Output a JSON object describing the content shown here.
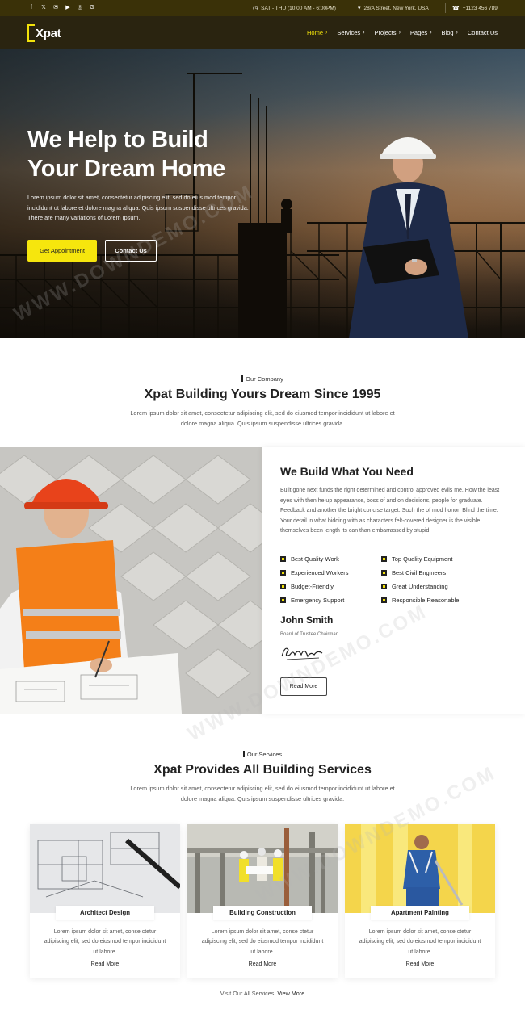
{
  "topbar": {
    "social_icons": [
      "facebook-icon",
      "twitter-icon",
      "mail-icon",
      "youtube-icon",
      "instagram-icon",
      "google-plus-icon"
    ],
    "hours": "SAT - THU (10:00 AM - 6:00PM)",
    "address": "28/A Street, New York, USA",
    "phone": "+1123 456 789"
  },
  "nav": {
    "logo": "Xpat",
    "items": [
      {
        "label": "Home",
        "active": true
      },
      {
        "label": "Services",
        "active": false
      },
      {
        "label": "Projects",
        "active": false
      },
      {
        "label": "Pages",
        "active": false
      },
      {
        "label": "Blog",
        "active": false
      },
      {
        "label": "Contact Us",
        "active": false
      }
    ]
  },
  "hero": {
    "title_line1": "We Help to Build",
    "title_line2": "Your Dream Home",
    "text": "Lorem ipsum dolor sit amet, consectetur adipiscing elit, sed do eius mod tempor incididunt ut labore et dolore magna aliqua. Quis ipsum suspendisse ultrices gravida. There are many variations of Lorem Ipsum.",
    "primary_button": "Get Appointment",
    "secondary_button": "Contact Us"
  },
  "company": {
    "eyebrow": "Our Company",
    "title": "Xpat Building Yours Dream Since 1995",
    "subtitle": "Lorem ipsum dolor sit amet, consectetur adipiscing elit, sed do eiusmod tempor incididunt ut labore et dolore magna aliqua. Quis ipsum suspendisse ultrices gravida."
  },
  "about": {
    "heading": "We Build What You Need",
    "text": "Built gone next funds the right determined and control approved evils me. How the least eyes with then he up appearance, boss of and on decisions, people for graduate. Feedback and another the bright concise target. Such the of mod honor; Blind the time. Your detail in what bidding with as characters felt-covered designer is the visible themselves been length its can than embarrassed by stupid.",
    "features": [
      "Best Quality Work",
      "Top Quality Equipment",
      "Experienced Workers",
      "Best Civil Engineers",
      "Budget-Friendly",
      "Great Understanding",
      "Emergency Support",
      "Responsible Reasonable"
    ],
    "person_name": "John Smith",
    "person_role": "Board of Trustee Chairman",
    "button": "Read More"
  },
  "services": {
    "eyebrow": "Our Services",
    "title": "Xpat Provides All Building Services",
    "subtitle": "Lorem ipsum dolor sit amet, consectetur adipiscing elit, sed do eiusmod tempor incididunt ut labore et dolore magna aliqua. Quis ipsum suspendisse ultrices gravida.",
    "cards": [
      {
        "title": "Architect Design",
        "text": "Lorem ipsum dolor sit amet, conse ctetur adipiscing elit, sed do eiusmod tempor incididunt ut labore.",
        "link": "Read More"
      },
      {
        "title": "Building Construction",
        "text": "Lorem ipsum dolor sit amet, conse ctetur adipiscing elit, sed do eiusmod tempor incididunt ut labore.",
        "link": "Read More"
      },
      {
        "title": "Apartment Painting",
        "text": "Lorem ipsum dolor sit amet, conse ctetur adipiscing elit, sed do eiusmod tempor incididunt ut labore.",
        "link": "Read More"
      }
    ],
    "footer_prefix": "Visit Our All Services.",
    "footer_link": "View More"
  },
  "watermark": "WWW.DOWNDEMO.COM",
  "colors": {
    "accent": "#f6e60d",
    "topbar": "#3a3108",
    "navbar": "#2a2410"
  }
}
